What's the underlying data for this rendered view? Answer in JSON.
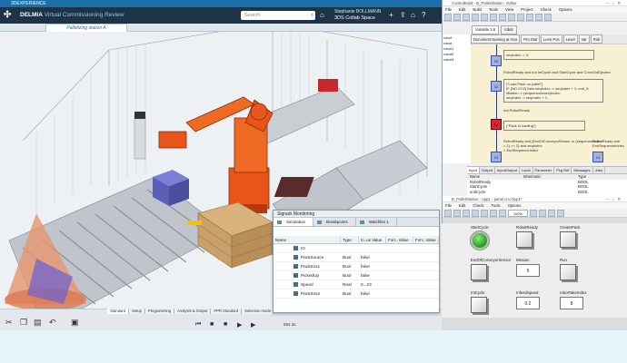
{
  "delmia": {
    "window_title": "3DEXPERIENCE",
    "brand": "DELMIA",
    "app_name": "Virtual Commissioning Review",
    "search_placeholder": "Search",
    "user_name": "Stephanie BOLLMANN",
    "space": "3DS Collab Space",
    "tab_label": "Palletizing station A",
    "mode_tabs": [
      "Standard",
      "Setup",
      "Programming",
      "Analysis & Output",
      "PPR Standard",
      "Selection mode"
    ],
    "active_mode_tab": 0,
    "time_value": "594.3s"
  },
  "signals": {
    "title": "Signals Monitoring",
    "tabs": [
      "Simulation",
      "Breakpoints",
      "Watchlist 1"
    ],
    "columns": [
      "Name",
      "Type",
      "In..us Value",
      "Forc..Value",
      "Forc..Value"
    ],
    "group": "IO",
    "rows": [
      {
        "name": "PackSource",
        "type": "Bool",
        "value": "false"
      },
      {
        "name": "PackSns1",
        "type": "Bool",
        "value": "false"
      },
      {
        "name": "PickedUp",
        "type": "Bool",
        "value": "false"
      },
      {
        "name": "Speed",
        "type": "Real",
        "value": "0...23"
      },
      {
        "name": "PackSns2",
        "type": "Bool",
        "value": "false"
      }
    ]
  },
  "plc_editor": {
    "title": "ControlBuild - B_PalletStation - Editor",
    "menu": [
      "File",
      "Edit",
      "Build",
      "Tools",
      "View",
      "Project",
      "Check",
      "Options"
    ],
    "tabs": [
      "Variable 3.8",
      "robot"
    ],
    "doc_tabs": [
      "Document Naming at Hoo",
      "Pro Dial",
      "Levn Pos",
      "Level",
      "Var",
      "Rob"
    ],
    "tree": [
      "robot",
      "robot",
      "robot1",
      "robot2",
      "robot3"
    ],
    "code_lines": [
      "seqIndex := 0;",
      "RobotReady and not IntCycle and StartCycle and ConvOutEjected",
      "[\"Load Pack on pallet\"]\nIF (NO XYZ) then seqIndex := seqIndex + 1; end_if;\nMission := (sequenceIndex)Index;\nseqIndex := seqIndex + 1;",
      "not RobotReady",
      "(\"Pack in loading\")",
      "RobotReady and (EndOfConveyorSensor or (sequenceIndex = 1) <= 2) and seqIndex\n> EndSequenceIndex"
    ],
    "step_labels": [
      "10",
      "11",
      "12",
      "13",
      "14"
    ],
    "side_label": "RobotReady and\nEndSequenceIndex",
    "var_tabs": [
      "Input",
      "Output",
      "Input/Output",
      "Local",
      "Parameter",
      "Pkg Ref",
      "Messages",
      "Jobs"
    ],
    "var_columns": [
      "Name",
      "Mnemonic",
      "Type"
    ],
    "var_rows": [
      {
        "name": "RobotReady",
        "type": "BOOL"
      },
      {
        "name": "StartCycle",
        "type": "BOOL"
      },
      {
        "name": "endCycle",
        "type": "BOOL"
      }
    ]
  },
  "hmi": {
    "title": "B_PalletStation - opp1 - panel.cm.Opp1*",
    "menu": [
      "File",
      "Edit",
      "Check",
      "Tools",
      "Options"
    ],
    "zoom": "100%",
    "widgets": [
      {
        "label": "StartCycle",
        "kind": "lamp"
      },
      {
        "label": "RobotReady",
        "kind": "button"
      },
      {
        "label": "CreatePack",
        "kind": "button"
      },
      {
        "label": "EndOfConveyorSensor",
        "kind": "button"
      },
      {
        "label": "Mission",
        "kind": "number",
        "value": "5"
      },
      {
        "label": "Run",
        "kind": "button"
      },
      {
        "label": "IntCycle",
        "kind": "button"
      },
      {
        "label": "InfeedSpeed",
        "kind": "number",
        "value": "0.2"
      },
      {
        "label": "robotTakeIndex",
        "kind": "number",
        "value": "8"
      }
    ]
  }
}
